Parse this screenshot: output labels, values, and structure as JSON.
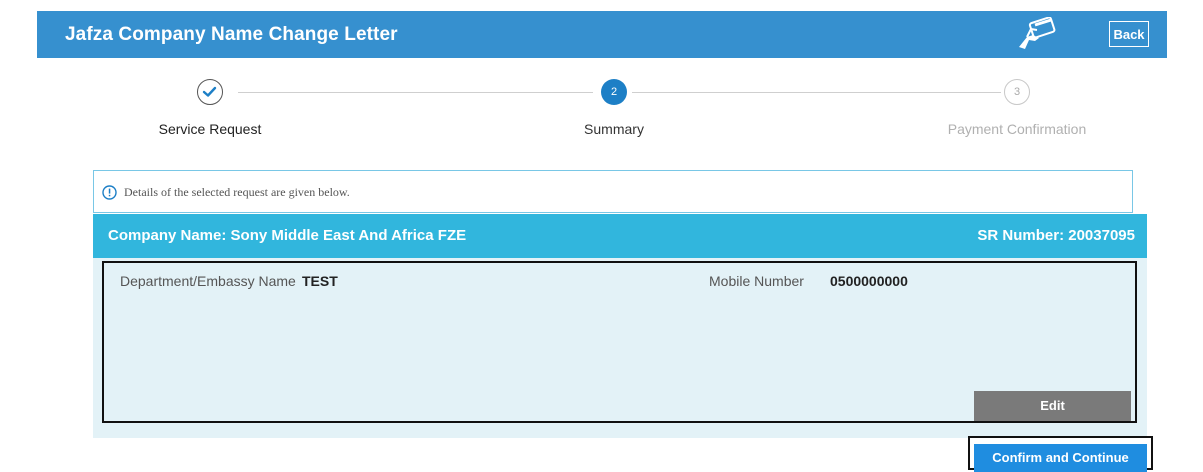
{
  "header": {
    "title": "Jafza Company Name Change Letter",
    "back_label": "Back",
    "bg_color": "#3690cf"
  },
  "stepper": {
    "steps": [
      {
        "number": "1",
        "label": "Service Request",
        "state": "completed"
      },
      {
        "number": "2",
        "label": "Summary",
        "state": "active"
      },
      {
        "number": "3",
        "label": "Payment Confirmation",
        "state": "pending"
      }
    ],
    "active_color": "#1d7fc6"
  },
  "info": {
    "text": "Details of the selected request are given below."
  },
  "request": {
    "company_label": "Company Name: Sony Middle East And Africa FZE",
    "sr_label": "SR Number: 20037095",
    "bar_color": "#31b6dd"
  },
  "details": {
    "department_label": "Department/Embassy Name",
    "department_value": "TEST",
    "mobile_label": "Mobile Number",
    "mobile_value": "0500000000",
    "edit_label": "Edit"
  },
  "actions": {
    "confirm_label": "Confirm and Continue"
  }
}
